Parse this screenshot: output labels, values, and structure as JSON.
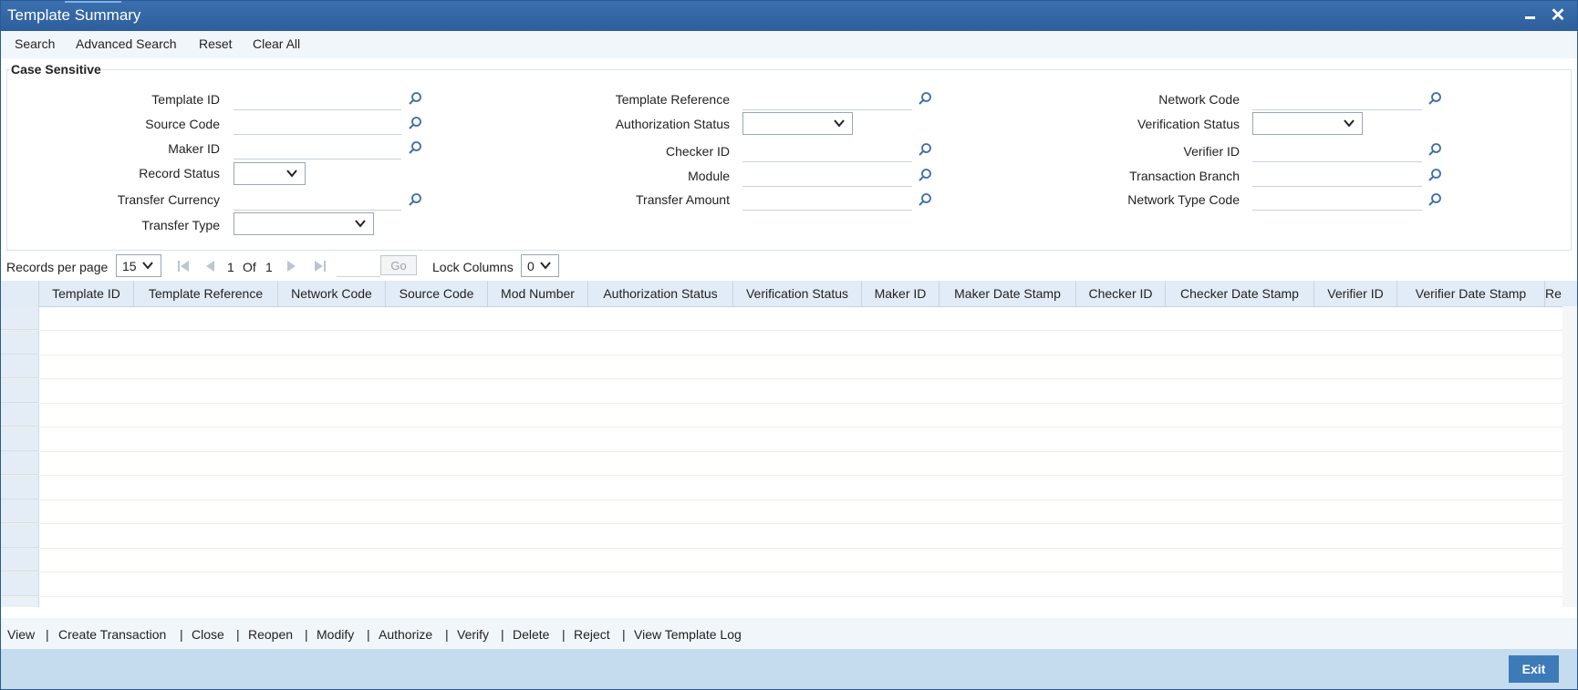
{
  "window": {
    "title": "Template Summary"
  },
  "toolbar": {
    "search": "Search",
    "advanced_search": "Advanced Search",
    "reset": "Reset",
    "clear_all": "Clear All"
  },
  "panel": {
    "legend": "Case Sensitive"
  },
  "fields": {
    "template_id": "Template ID",
    "source_code": "Source Code",
    "maker_id": "Maker ID",
    "record_status": "Record Status",
    "transfer_currency": "Transfer Currency",
    "transfer_type": "Transfer Type",
    "template_reference": "Template Reference",
    "authorization_status": "Authorization Status",
    "checker_id": "Checker ID",
    "module": "Module",
    "transfer_amount": "Transfer Amount",
    "network_code": "Network Code",
    "verification_status": "Verification Status",
    "verifier_id": "Verifier ID",
    "transaction_branch": "Transaction Branch",
    "network_type_code": "Network Type Code"
  },
  "pager": {
    "records_per_page_label": "Records per page",
    "records_per_page": "15",
    "current_page": "1",
    "of_label": "Of",
    "total_pages": "1",
    "go": "Go",
    "lock_columns_label": "Lock Columns",
    "lock_columns": "0"
  },
  "grid": {
    "columns": [
      "Template ID",
      "Template Reference",
      "Network Code",
      "Source Code",
      "Mod Number",
      "Authorization Status",
      "Verification Status",
      "Maker ID",
      "Maker Date Stamp",
      "Checker ID",
      "Checker Date Stamp",
      "Verifier ID",
      "Verifier Date Stamp",
      "Re"
    ],
    "rows": []
  },
  "actions": [
    "View",
    "Create Transaction",
    "Close",
    "Reopen",
    "Modify",
    "Authorize",
    "Verify",
    "Delete",
    "Reject",
    "View Template Log"
  ],
  "footer": {
    "exit": "Exit"
  },
  "icons": {
    "lookup": "search-icon",
    "dropdown": "chevron-down-icon"
  },
  "colors": {
    "titlebar": "#2e5f9c",
    "footer": "#c5dcee",
    "exit_button": "#3c7bb8",
    "grid_header": "#e2ecf6"
  }
}
